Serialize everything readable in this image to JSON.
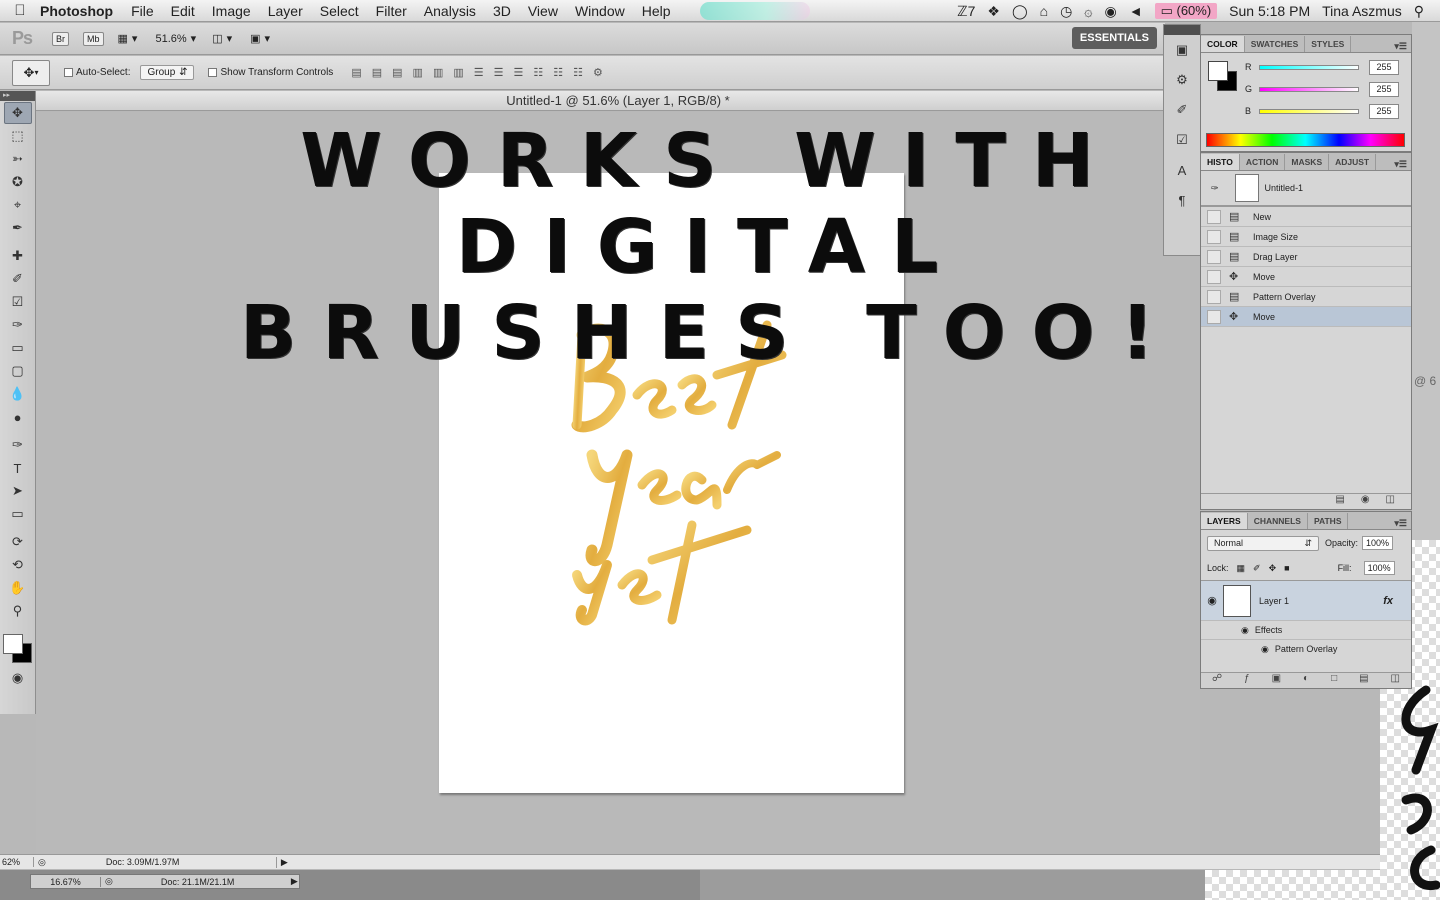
{
  "menubar": {
    "app_name": "Photoshop",
    "items": [
      "File",
      "Edit",
      "Image",
      "Layer",
      "Select",
      "Filter",
      "Analysis",
      "3D",
      "View",
      "Window",
      "Help"
    ],
    "status_a": "7",
    "battery": "(60%)",
    "clock": "Sun 5:18 PM",
    "user": "Tina Aszmus"
  },
  "appbar": {
    "logo": "Ps",
    "br": "Br",
    "mb": "Mb",
    "zoom": "51.6%",
    "workspace": "ESSENTIALS"
  },
  "options": {
    "auto_select_label": "Auto-Select:",
    "group_value": "Group",
    "transform_label": "Show Transform Controls"
  },
  "document": {
    "title": "Untitled-1 @ 51.6% (Layer 1, RGB/8) *"
  },
  "headline": {
    "line1": "WORKS WITH DIGITAL",
    "line2": "BRUSHES TOO!"
  },
  "status": {
    "zoom": "62%",
    "doc_size": "Doc: 3.09M/1.97M",
    "zoom2": "16.67%",
    "doc_size2": "Doc: 21.1M/21.1M"
  },
  "color_panel": {
    "tabs": [
      "COLOR",
      "SWATCHES",
      "STYLES"
    ],
    "r_label": "R",
    "g_label": "G",
    "b_label": "B",
    "r": "255",
    "g": "255",
    "b": "255"
  },
  "history_panel": {
    "tabs": [
      "HISTO",
      "ACTION",
      "MASKS",
      "ADJUST"
    ],
    "snapshot": "Untitled-1",
    "states": [
      "New",
      "Image Size",
      "Drag Layer",
      "Move",
      "Pattern Overlay",
      "Move"
    ]
  },
  "layers_panel": {
    "tabs": [
      "LAYERS",
      "CHANNELS",
      "PATHS"
    ],
    "blend_mode": "Normal",
    "opacity_label": "Opacity:",
    "opacity": "100%",
    "lock_label": "Lock:",
    "fill_label": "Fill:",
    "fill": "100%",
    "layer_name": "Layer 1",
    "fx_label": "fx",
    "effects_label": "Effects",
    "effect_name": "Pattern Overlay"
  },
  "misc": {
    "peek_text": "@ 6"
  },
  "colors": {
    "gold": "#e8b64a",
    "selection": "#b9c6d6"
  }
}
